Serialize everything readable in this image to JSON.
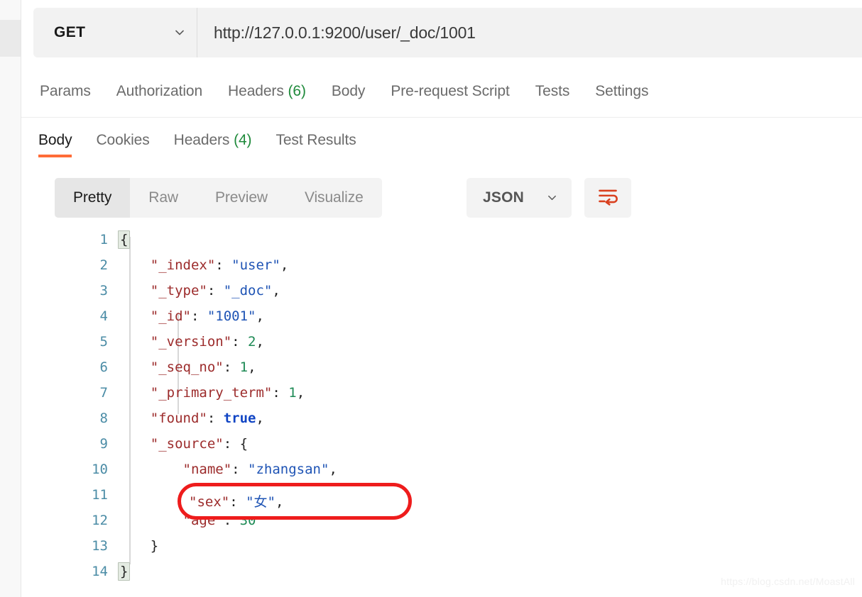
{
  "app": {
    "watermark": "https://blog.csdn.net/MoastAll",
    "accent_orange": "#ff6c37",
    "wrap_icon_color": "#d9401f",
    "annotation_color": "#ee1c1c"
  },
  "url_bar": {
    "method": "GET",
    "method_chevron": "chevron-down-icon",
    "url": "http://127.0.0.1:9200/user/_doc/1001"
  },
  "request_tabs": [
    {
      "label": "Params",
      "count": "",
      "active": false
    },
    {
      "label": "Authorization",
      "count": "",
      "active": false
    },
    {
      "label": "Headers",
      "count": "(6)",
      "active": false
    },
    {
      "label": "Body",
      "count": "",
      "active": false
    },
    {
      "label": "Pre-request Script",
      "count": "",
      "active": false
    },
    {
      "label": "Tests",
      "count": "",
      "active": false
    },
    {
      "label": "Settings",
      "count": "",
      "active": false
    }
  ],
  "response_tabs": [
    {
      "label": "Body",
      "count": "",
      "active": true
    },
    {
      "label": "Cookies",
      "count": "",
      "active": false
    },
    {
      "label": "Headers",
      "count": "(4)",
      "active": false
    },
    {
      "label": "Test Results",
      "count": "",
      "active": false
    }
  ],
  "body_toolbar": {
    "view_modes": [
      {
        "label": "Pretty",
        "active": true
      },
      {
        "label": "Raw",
        "active": false
      },
      {
        "label": "Preview",
        "active": false
      },
      {
        "label": "Visualize",
        "active": false
      }
    ],
    "format": "JSON",
    "format_chevron": "chevron-down-icon",
    "wrap_button": "wrap-lines-icon"
  },
  "code": {
    "lines": [
      {
        "num": "1",
        "segments": [
          {
            "t": "{",
            "c": "brace"
          }
        ]
      },
      {
        "num": "2",
        "segments": [
          {
            "t": "    ",
            "c": "p"
          },
          {
            "t": "\"_index\"",
            "c": "k"
          },
          {
            "t": ": ",
            "c": "p"
          },
          {
            "t": "\"user\"",
            "c": "s"
          },
          {
            "t": ",",
            "c": "p"
          }
        ]
      },
      {
        "num": "3",
        "segments": [
          {
            "t": "    ",
            "c": "p"
          },
          {
            "t": "\"_type\"",
            "c": "k"
          },
          {
            "t": ": ",
            "c": "p"
          },
          {
            "t": "\"_doc\"",
            "c": "s"
          },
          {
            "t": ",",
            "c": "p"
          }
        ]
      },
      {
        "num": "4",
        "segments": [
          {
            "t": "    ",
            "c": "p"
          },
          {
            "t": "\"_id\"",
            "c": "k"
          },
          {
            "t": ": ",
            "c": "p"
          },
          {
            "t": "\"1001\"",
            "c": "s"
          },
          {
            "t": ",",
            "c": "p"
          }
        ]
      },
      {
        "num": "5",
        "segments": [
          {
            "t": "    ",
            "c": "p"
          },
          {
            "t": "\"_version\"",
            "c": "k"
          },
          {
            "t": ": ",
            "c": "p"
          },
          {
            "t": "2",
            "c": "n"
          },
          {
            "t": ",",
            "c": "p"
          }
        ]
      },
      {
        "num": "6",
        "segments": [
          {
            "t": "    ",
            "c": "p"
          },
          {
            "t": "\"_seq_no\"",
            "c": "k"
          },
          {
            "t": ": ",
            "c": "p"
          },
          {
            "t": "1",
            "c": "n"
          },
          {
            "t": ",",
            "c": "p"
          }
        ]
      },
      {
        "num": "7",
        "segments": [
          {
            "t": "    ",
            "c": "p"
          },
          {
            "t": "\"_primary_term\"",
            "c": "k"
          },
          {
            "t": ": ",
            "c": "p"
          },
          {
            "t": "1",
            "c": "n"
          },
          {
            "t": ",",
            "c": "p"
          }
        ]
      },
      {
        "num": "8",
        "segments": [
          {
            "t": "    ",
            "c": "p"
          },
          {
            "t": "\"found\"",
            "c": "k"
          },
          {
            "t": ": ",
            "c": "p"
          },
          {
            "t": "true",
            "c": "b"
          },
          {
            "t": ",",
            "c": "p"
          }
        ]
      },
      {
        "num": "9",
        "segments": [
          {
            "t": "    ",
            "c": "p"
          },
          {
            "t": "\"_source\"",
            "c": "k"
          },
          {
            "t": ": {",
            "c": "p"
          }
        ]
      },
      {
        "num": "10",
        "segments": [
          {
            "t": "        ",
            "c": "p"
          },
          {
            "t": "\"name\"",
            "c": "k"
          },
          {
            "t": ": ",
            "c": "p"
          },
          {
            "t": "\"zhangsan\"",
            "c": "s"
          },
          {
            "t": ",",
            "c": "p"
          }
        ]
      },
      {
        "num": "11",
        "segments": [
          {
            "t": "        ",
            "c": "p"
          },
          {
            "t": "\"sex\"",
            "c": "k"
          },
          {
            "t": ": ",
            "c": "p"
          },
          {
            "t": "\"女\"",
            "c": "s"
          },
          {
            "t": ",",
            "c": "p"
          }
        ]
      },
      {
        "num": "12",
        "segments": [
          {
            "t": "        ",
            "c": "p"
          },
          {
            "t": "\"age\"",
            "c": "k"
          },
          {
            "t": ": ",
            "c": "p"
          },
          {
            "t": "30",
            "c": "n"
          }
        ]
      },
      {
        "num": "13",
        "segments": [
          {
            "t": "    }",
            "c": "p"
          }
        ]
      },
      {
        "num": "14",
        "segments": [
          {
            "t": "}",
            "c": "brace"
          }
        ]
      }
    ]
  },
  "annotation": {
    "highlighted_line_number": "11",
    "segments": [
      {
        "t": "\"sex\"",
        "c": "k"
      },
      {
        "t": ": ",
        "c": "p"
      },
      {
        "t": "\"女\"",
        "c": "s"
      },
      {
        "t": ",",
        "c": "p"
      }
    ]
  }
}
